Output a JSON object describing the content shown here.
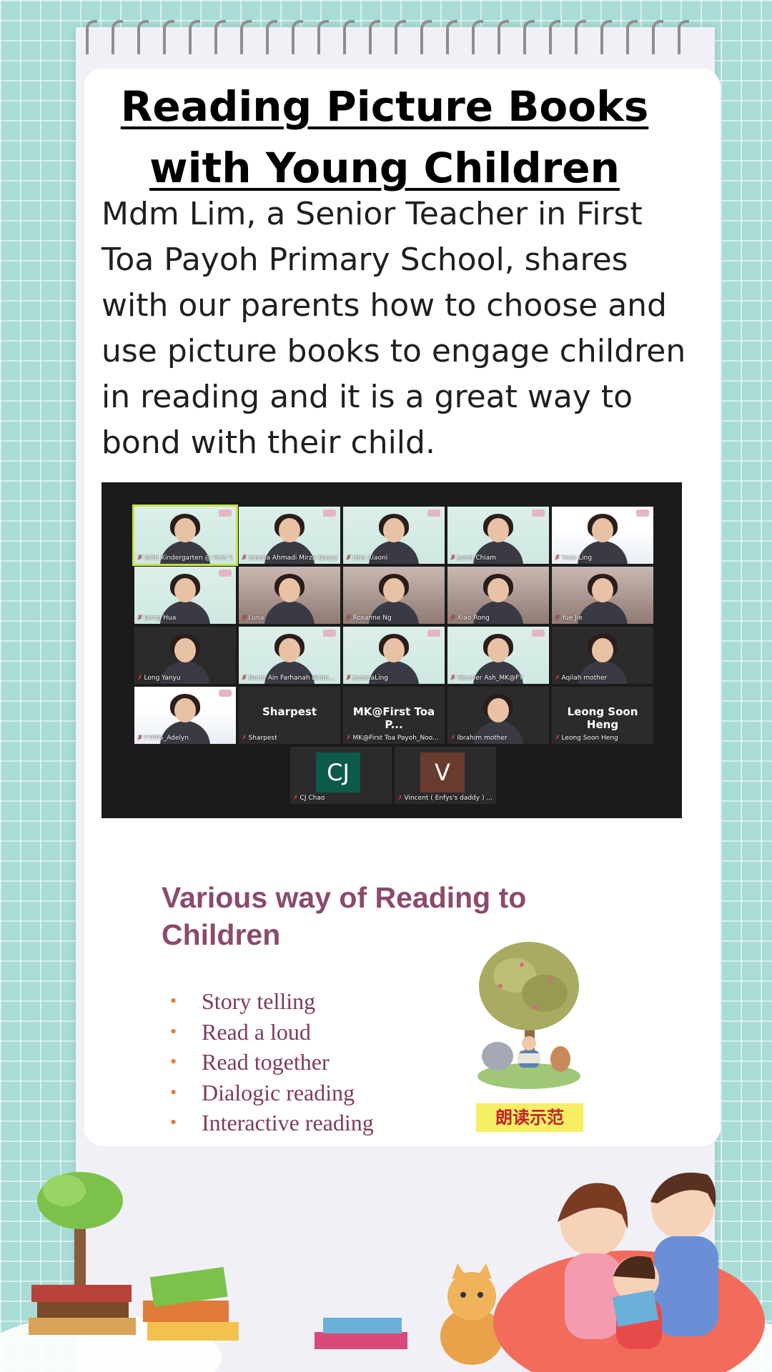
{
  "title": "Reading Picture Books with Young Children",
  "description": "Mdm Lim, a Senior Teacher in First Toa Payoh Primary School, shares with our parents how to choose and use picture books to engage children in reading and it is a great way to bond with their child.",
  "zoom_call": {
    "participants": [
      {
        "name": "MOE Kindergarten @ First T...",
        "kind": "video",
        "bg": "room"
      },
      {
        "name": "Saleha Ahmadi Mirza Quaya...",
        "kind": "video",
        "bg": "room"
      },
      {
        "name": "Han Xiaoni",
        "kind": "video",
        "bg": "room"
      },
      {
        "name": "Janet Chiam",
        "kind": "video",
        "bg": "room"
      },
      {
        "name": "Tiew Ling",
        "kind": "video",
        "bg": "school"
      },
      {
        "name": "Deng Hua",
        "kind": "video",
        "bg": "room"
      },
      {
        "name": "Luna",
        "kind": "video",
        "bg": "home"
      },
      {
        "name": "Roxanne Ng",
        "kind": "video",
        "bg": "home"
      },
      {
        "name": "Xiao Rong",
        "kind": "video",
        "bg": "home"
      },
      {
        "name": "Yue Jie",
        "kind": "video",
        "bg": "home"
      },
      {
        "name": "Long Yanyu",
        "kind": "video",
        "bg": "dark"
      },
      {
        "name": "Nurul Ain Farhanah Binte...",
        "kind": "video",
        "bg": "room"
      },
      {
        "name": "JessicaLing",
        "kind": "video",
        "bg": "room"
      },
      {
        "name": "Teacher Ash_MK@FY",
        "kind": "video",
        "bg": "room"
      },
      {
        "name": "Aqilah mother",
        "kind": "video",
        "bg": "dark"
      },
      {
        "name": "FTPPS_Adelyn",
        "kind": "video",
        "bg": "school"
      },
      {
        "name": "Sharpest",
        "kind": "text",
        "big": "Sharpest"
      },
      {
        "name": "MK@First Toa Payoh_Noo...",
        "kind": "text",
        "big": "MK@First Toa P..."
      },
      {
        "name": "Ibrahim mother",
        "kind": "video",
        "bg": "dark"
      },
      {
        "name": "Leong Soon Heng",
        "kind": "text",
        "big": "Leong Soon Heng"
      },
      {
        "name": "CJ Chao",
        "kind": "initial",
        "initial": "CJ",
        "color": "#0e5a4a"
      },
      {
        "name": "Vincent ( Enfys's daddy ) ...",
        "kind": "initial",
        "initial": "V",
        "color": "#6a3b2f"
      }
    ]
  },
  "slide": {
    "heading": "Various way of Reading to Children",
    "items": [
      "Story telling",
      "Read a loud",
      "Read together",
      "Dialogic reading",
      "Interactive reading"
    ],
    "caption": "朗读示范"
  },
  "colors": {
    "background": "#a9dcd6",
    "slide_heading": "#8b4a6e",
    "bullet": "#e8793a",
    "caption_bg": "#f7ef63"
  }
}
